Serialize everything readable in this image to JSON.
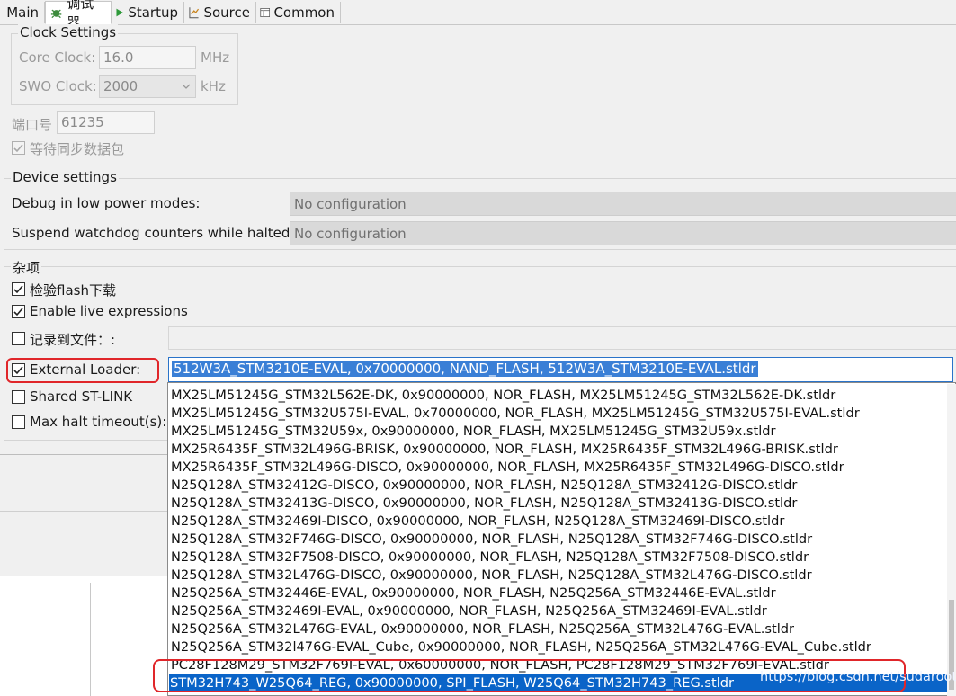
{
  "tabs": [
    {
      "label": "Main",
      "icon": "main-tab-icon"
    },
    {
      "label": "调试器",
      "icon": "debugger-icon"
    },
    {
      "label": "Startup",
      "icon": "play-icon"
    },
    {
      "label": "Source",
      "icon": "source-icon"
    },
    {
      "label": "Common",
      "icon": "common-icon"
    }
  ],
  "clock": {
    "title": "Clock Settings",
    "core_label": "Core Clock:",
    "core_value": "16.0",
    "core_unit": "MHz",
    "swo_label": "SWO Clock:",
    "swo_value": "2000",
    "swo_unit": "kHz"
  },
  "port": {
    "label": "端口号",
    "value": "61235"
  },
  "wait_sync": {
    "label": "等待同步数据包",
    "checked": true
  },
  "device": {
    "title": "Device settings",
    "low_power_label": "Debug in low power modes:",
    "low_power_value": "No configuration",
    "watchdog_label": "Suspend watchdog counters while halted:",
    "watchdog_value": "No configuration"
  },
  "misc": {
    "title": "杂项",
    "verify_flash": "检验flash下载",
    "live_expressions": "Enable live expressions",
    "log_to_file": "记录到文件：:",
    "external_loader": "External Loader:",
    "shared_stlink": "Shared ST-LINK",
    "max_halt": "Max halt timeout(s):"
  },
  "loader_combo": {
    "value": "512W3A_STM3210E-EVAL, 0x70000000, NAND_FLASH, 512W3A_STM3210E-EVAL.stldr"
  },
  "dropdown_items": [
    "MX25LM51245G_STM32L562E-DK, 0x90000000, NOR_FLASH, MX25LM51245G_STM32L562E-DK.stldr",
    "MX25LM51245G_STM32U575I-EVAL, 0x70000000, NOR_FLASH, MX25LM51245G_STM32U575I-EVAL.stldr",
    "MX25LM51245G_STM32U59x, 0x90000000, NOR_FLASH, MX25LM51245G_STM32U59x.stldr",
    "MX25R6435F_STM32L496G-BRISK, 0x90000000, NOR_FLASH, MX25R6435F_STM32L496G-BRISK.stldr",
    "MX25R6435F_STM32L496G-DISCO, 0x90000000, NOR_FLASH, MX25R6435F_STM32L496G-DISCO.stldr",
    "N25Q128A_STM32412G-DISCO, 0x90000000, NOR_FLASH, N25Q128A_STM32412G-DISCO.stldr",
    "N25Q128A_STM32413G-DISCO, 0x90000000, NOR_FLASH, N25Q128A_STM32413G-DISCO.stldr",
    "N25Q128A_STM32469I-DISCO, 0x90000000, NOR_FLASH, N25Q128A_STM32469I-DISCO.stldr",
    "N25Q128A_STM32F746G-DISCO, 0x90000000, NOR_FLASH, N25Q128A_STM32F746G-DISCO.stldr",
    "N25Q128A_STM32F7508-DISCO, 0x90000000, NOR_FLASH, N25Q128A_STM32F7508-DISCO.stldr",
    "N25Q128A_STM32L476G-DISCO, 0x90000000, NOR_FLASH, N25Q128A_STM32L476G-DISCO.stldr",
    "N25Q256A_STM32446E-EVAL, 0x90000000, NOR_FLASH, N25Q256A_STM32446E-EVAL.stldr",
    "N25Q256A_STM32469I-EVAL, 0x90000000, NOR_FLASH, N25Q256A_STM32469I-EVAL.stldr",
    "N25Q256A_STM32L476G-EVAL, 0x90000000, NOR_FLASH, N25Q256A_STM32L476G-EVAL.stldr",
    "N25Q256A_STM32l476G-EVAL_Cube, 0x90000000, NOR_FLASH, N25Q256A_STM32L476G-EVAL_Cube.stldr",
    "PC28F128M29_STM32F769I-EVAL, 0x60000000, NOR_FLASH, PC28F128M29_STM32F769I-EVAL.stldr",
    "STM32H743_W25Q64_REG, 0x90000000, SPI_FLASH, W25Q64_STM32H743_REG.stldr"
  ],
  "selected_index": 16,
  "watermark": "https://blog.csdn.net/sudaroot",
  "colors": {
    "selection": "#0a64c8",
    "highlight": "#e0262a",
    "disabled_field": "#d9d9d9"
  }
}
